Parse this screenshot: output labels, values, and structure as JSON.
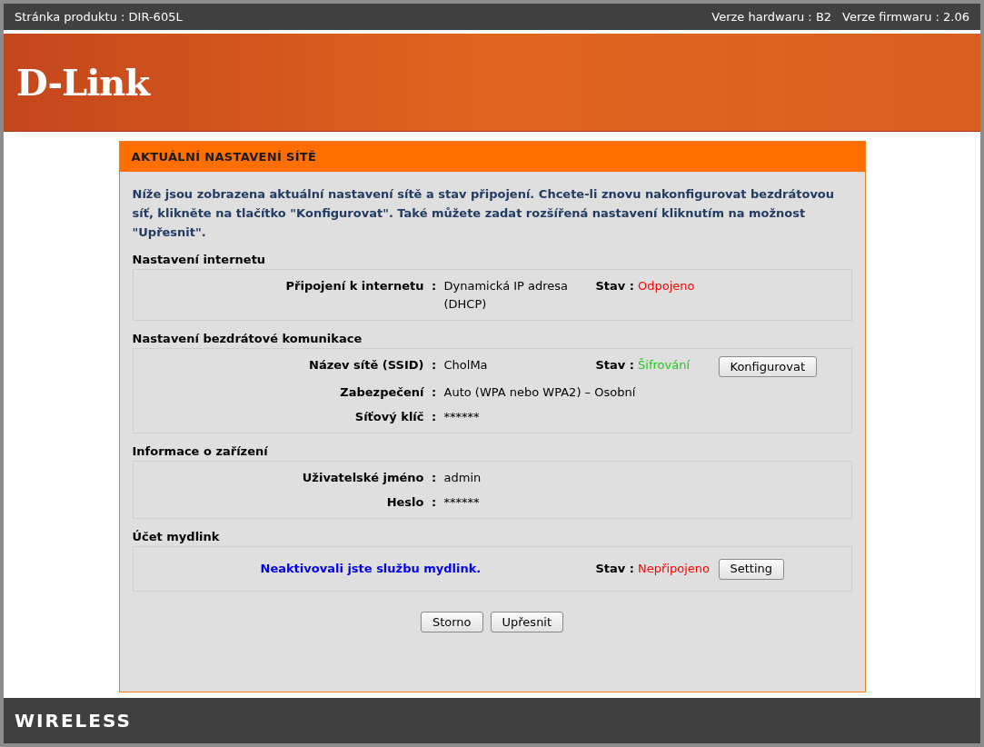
{
  "top_bar": {
    "product": "Stránka produktu : DIR-605L",
    "hardware": "Verze hardwaru : B2",
    "firmware": "Verze firmwaru : 2.06"
  },
  "logo": "D-Link",
  "panel": {
    "title": "AKTUÁLNÍ NASTAVENÍ SÍTĚ",
    "intro": "Níže jsou zobrazena aktuální nastavení sítě a stav připojení. Chcete-li znovu nakonfigurovat bezdrátovou síť, klikněte na tlačítko \"Konfigurovat\". Také můžete zadat rozšířená nastavení kliknutím na možnost \"Upřesnit\".",
    "sections": [
      {
        "title": "Nastavení internetu",
        "rows": [
          {
            "kind": "field",
            "label": "Připojení k internetu",
            "colon": ":",
            "value": "Dynamická IP adresa (DHCP)",
            "status_label": "Stav :",
            "status": "Odpojeno",
            "color": "#ff0000"
          }
        ]
      },
      {
        "title": "Nastavení bezdrátové komunikace",
        "rows": [
          {
            "kind": "field",
            "label": "Název sítě (SSID)",
            "colon": ":",
            "value": "CholMa",
            "status_label": "Stav :",
            "status": "Šifrování",
            "color": "#1ec81e",
            "button": "Konfigurovat"
          },
          {
            "kind": "field",
            "label": "Zabezpečení",
            "colon": ":",
            "value": "Auto (WPA nebo WPA2) – Osobní"
          },
          {
            "kind": "field",
            "label": "Síťový klíč",
            "colon": ":",
            "value": "******"
          }
        ]
      },
      {
        "title": "Informace o zařízení",
        "rows": [
          {
            "kind": "field",
            "label": "Uživatelské jméno",
            "colon": ":",
            "value": "admin"
          },
          {
            "kind": "field",
            "label": "Heslo",
            "colon": ":",
            "value": "******"
          }
        ]
      },
      {
        "title": "Účet mydlink",
        "rows": [
          {
            "kind": "message",
            "text": "Neaktivovali jste službu mydlink.",
            "status_label": "Stav :",
            "status": "Nepřipojeno",
            "color": "#ff0000",
            "button": "Setting"
          }
        ]
      }
    ],
    "buttons": [
      "Storno",
      "Upřesnit"
    ]
  },
  "footer": "WIRELESS"
}
